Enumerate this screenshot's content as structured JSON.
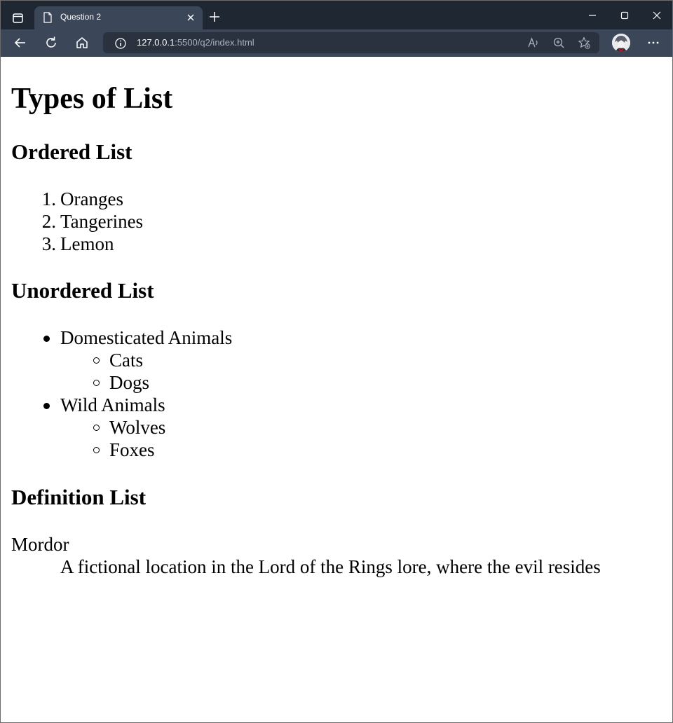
{
  "browser": {
    "tab_title": "Question 2",
    "url_host": "127.0.0.1",
    "url_rest": ":5500/q2/index.html",
    "colors": {
      "tabstrip": "#1f2733",
      "toolbar": "#3b4658",
      "addressbar": "#2a3240"
    }
  },
  "page": {
    "title": "Types of List",
    "ordered": {
      "heading": "Ordered List",
      "items": [
        {
          "num": "1.",
          "label": "Oranges"
        },
        {
          "num": "2.",
          "label": "Tangerines"
        },
        {
          "num": "3.",
          "label": "Lemon"
        }
      ]
    },
    "unordered": {
      "heading": "Unordered List",
      "groups": [
        {
          "label": "Domesticated Animals",
          "children": [
            "Cats",
            "Dogs"
          ]
        },
        {
          "label": "Wild Animals",
          "children": [
            "Wolves",
            "Foxes"
          ]
        }
      ]
    },
    "definition": {
      "heading": "Definition List",
      "term": "Mordor",
      "description": "A fictional location in the Lord of the Rings lore, where the evil resides"
    }
  }
}
